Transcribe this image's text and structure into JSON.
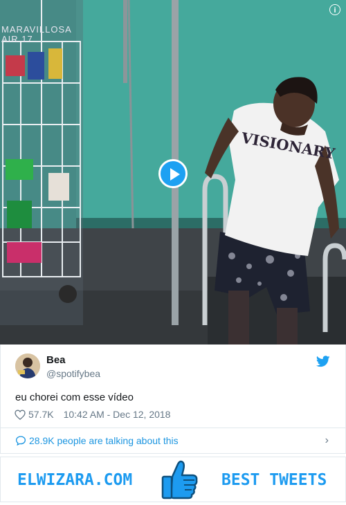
{
  "video": {
    "shirt_text": "VISIONARY",
    "store_sign_line1": "MARAVILLOSA",
    "store_sign_line2": "AIR 17",
    "info_icon": "info-icon",
    "play_icon": "play-icon"
  },
  "tweet": {
    "name": "Bea",
    "handle": "@spotifybea",
    "text": "eu chorei com esse vídeo",
    "likes": "57.7K",
    "timestamp": "10:42 AM - Dec 12, 2018"
  },
  "conversation": {
    "text": "28.9K people are talking about this",
    "chevron": "›"
  },
  "banner": {
    "left_text": "ELWIZARA.COM",
    "right_text": "BEST TWEETS"
  },
  "colors": {
    "twitter_blue": "#1da1f2",
    "link_blue": "#1b95e0",
    "gray_text": "#657786",
    "pool_wall": "#3fa596"
  }
}
